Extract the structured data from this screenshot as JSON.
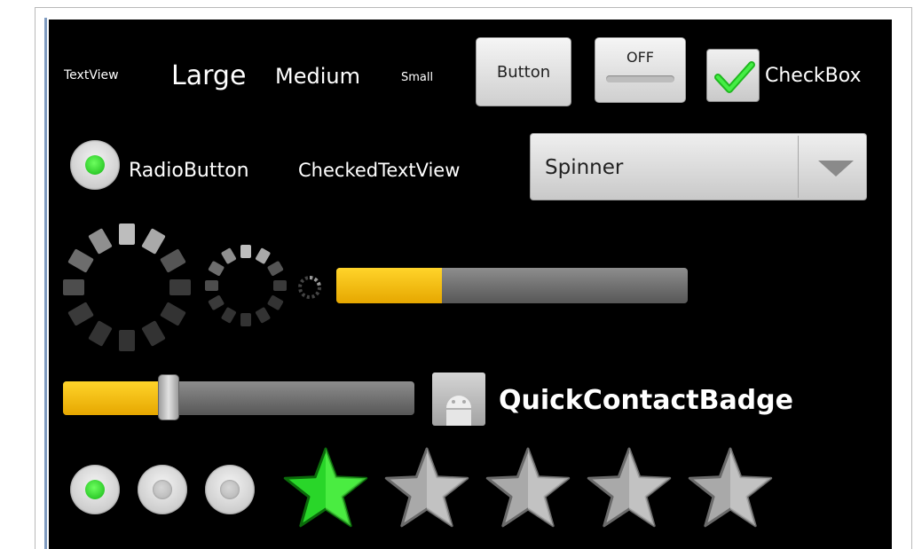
{
  "widgets": {
    "textviews": {
      "textview": "TextView",
      "large": "Large",
      "medium": "Medium",
      "small": "Small"
    },
    "button": {
      "label": "Button"
    },
    "toggle": {
      "label": "OFF",
      "checked": false
    },
    "checkbox": {
      "label": "CheckBox",
      "checked": true
    },
    "radio": {
      "label": "RadioButton",
      "checked": true
    },
    "checked_textview": {
      "label": "CheckedTextView"
    },
    "spinner": {
      "selected": "Spinner"
    },
    "progress_bar": {
      "progress": 0.3
    },
    "seekbar": {
      "progress": 0.3
    },
    "quick_contact_badge": {
      "label": "QuickContactBadge"
    },
    "radio_group": [
      {
        "checked": true
      },
      {
        "checked": false
      },
      {
        "checked": false
      }
    ],
    "rating_bar": {
      "rating": 1,
      "max": 5
    }
  },
  "colors": {
    "accent_green": "#1fd41f",
    "progress_yellow": "#f5bd00",
    "background": "#000000"
  },
  "icons": {
    "checkmark": "checkmark-icon",
    "spinner_arrow": "triangle-down-icon",
    "contact_placeholder": "android-contact-icon",
    "star": "star-icon"
  }
}
